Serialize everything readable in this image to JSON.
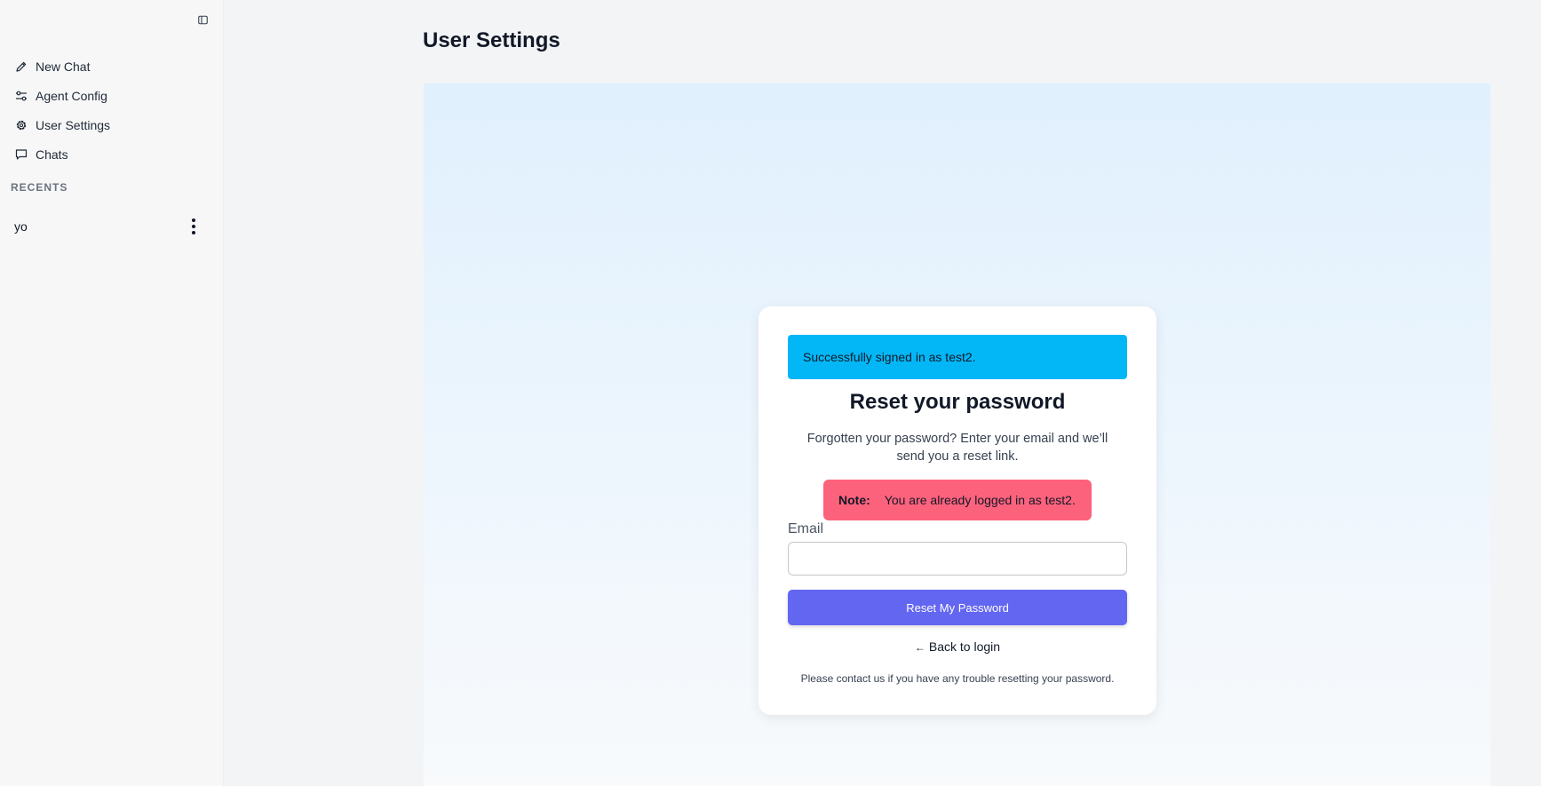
{
  "sidebar": {
    "collapse_icon": "sidebar-collapse-icon",
    "items": [
      {
        "label": "New Chat",
        "icon": "pencil-icon"
      },
      {
        "label": "Agent Config",
        "icon": "sliders-icon"
      },
      {
        "label": "User Settings",
        "icon": "gear-icon"
      },
      {
        "label": "Chats",
        "icon": "chat-bubble-icon"
      }
    ],
    "recents_title": "RECENTS",
    "recents": [
      {
        "label": "yo",
        "menu_icon": "kebab-menu-icon"
      }
    ]
  },
  "main": {
    "title": "User Settings"
  },
  "card": {
    "success_message": "Successfully signed in as test2.",
    "title": "Reset your password",
    "subtitle": "Forgotten your password? Enter your email and we’ll send you a reset link.",
    "note_label": "Note:",
    "note_text": "You are already logged in as test2.",
    "email_label": "Email",
    "email_value": "",
    "email_placeholder": "",
    "submit_label": "Reset My Password",
    "back_arrow": "←",
    "back_label": "Back to login",
    "help_text": "Please contact us if you have any trouble resetting your password."
  },
  "colors": {
    "success_bg": "#03b7f6",
    "note_bg": "#fd627c",
    "primary_button": "#6366f1"
  }
}
